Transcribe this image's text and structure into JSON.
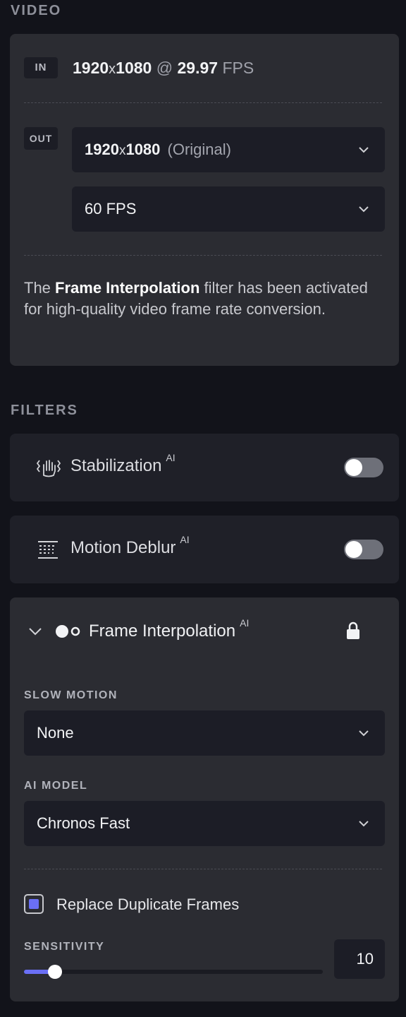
{
  "video": {
    "section_title": "VIDEO",
    "in_badge": "IN",
    "in_width": "1920",
    "in_x": "x",
    "in_height": "1080",
    "in_at": "@",
    "in_fps_value": "29.97",
    "in_fps_unit": "FPS",
    "out_badge": "OUT",
    "out_res_width": "1920",
    "out_res_x": "x",
    "out_res_height": "1080",
    "out_res_note": "(Original)",
    "out_fps": "60 FPS",
    "note_pre": "The ",
    "note_bold": "Frame Interpolation",
    "note_post": " filter has been activated for high-quality video frame rate conversion."
  },
  "filters": {
    "section_title": "FILTERS",
    "stabilization": {
      "label": "Stabilization",
      "ai": "AI",
      "enabled": false,
      "icon": "stabilization-hand-icon"
    },
    "motion_deblur": {
      "label": "Motion Deblur",
      "ai": "AI",
      "enabled": false,
      "icon": "deblur-lines-icon"
    },
    "frame_interpolation": {
      "label": "Frame Interpolation",
      "ai": "AI",
      "icon": "interpolation-dots-icon",
      "lock_icon": "lock-icon",
      "slow_motion_label": "SLOW MOTION",
      "slow_motion_value": "None",
      "ai_model_label": "AI MODEL",
      "ai_model_value": "Chronos Fast",
      "replace_duplicates_label": "Replace Duplicate Frames",
      "replace_duplicates_checked": true,
      "sensitivity_label": "SENSITIVITY",
      "sensitivity_value": "10",
      "sensitivity_fraction": 0.1
    }
  },
  "colors": {
    "accent": "#6a6ff5",
    "background": "#12131a",
    "card": "#2b2c32"
  }
}
